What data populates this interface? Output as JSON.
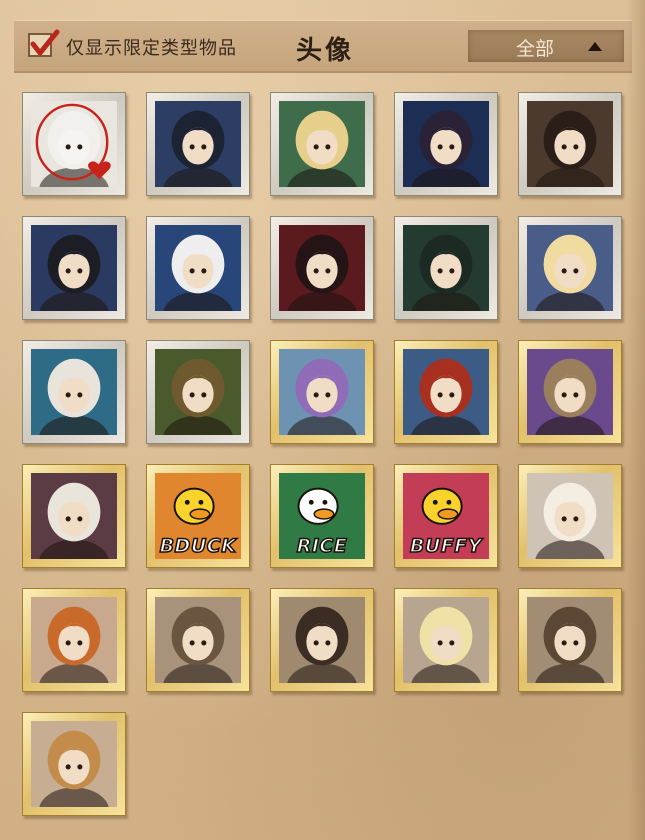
{
  "header": {
    "filter_label": "仅显示限定类型物品",
    "filter_checked": true,
    "title": "头像",
    "dropdown_value": "全部"
  },
  "colors": {
    "background": "#d5b58a",
    "frame_silver": "#e6e2da",
    "frame_gold": "#e8c874",
    "check_red": "#b8261c"
  },
  "avatars": [
    {
      "icon": "white-haired-doll-portrait",
      "frame": "silver",
      "bg": "#e9e6df",
      "selected": true
    },
    {
      "icon": "dark-armored-hunter-portrait",
      "frame": "silver",
      "bg": "#2c3e63"
    },
    {
      "icon": "blonde-green-goggles-portrait",
      "frame": "silver",
      "bg": "#3f6d4c"
    },
    {
      "icon": "dark-and-pale-pair-portrait",
      "frame": "silver",
      "bg": "#1d2e55"
    },
    {
      "icon": "dark-curly-hair-steampunk-portrait",
      "frame": "silver",
      "bg": "#4c3a2e"
    },
    {
      "icon": "dark-and-white-pair-portrait",
      "frame": "silver",
      "bg": "#2a3a60"
    },
    {
      "icon": "white-hair-top-hat-portrait",
      "frame": "silver",
      "bg": "#28467a"
    },
    {
      "icon": "red-flower-girl-portrait",
      "frame": "silver",
      "bg": "#5a1a1e"
    },
    {
      "icon": "dark-haired-ghost-portrait",
      "frame": "silver",
      "bg": "#243b32"
    },
    {
      "icon": "blonde-blindfold-portrait",
      "frame": "silver",
      "bg": "#4a5c88"
    },
    {
      "icon": "white-curls-masked-portrait",
      "frame": "silver",
      "bg": "#2d6b86"
    },
    {
      "icon": "mechanical-creature-portrait",
      "frame": "silver",
      "bg": "#4b5a2c"
    },
    {
      "icon": "purple-hooded-figure-portrait",
      "frame": "gold",
      "bg": "#6e93b2"
    },
    {
      "icon": "red-haired-masked-figure-portrait",
      "frame": "gold",
      "bg": "#3c5c86"
    },
    {
      "icon": "box-head-figure-portrait",
      "frame": "gold",
      "bg": "#6a4a8c"
    },
    {
      "icon": "white-haired-man-portrait",
      "frame": "gold",
      "bg": "#5b3b44"
    },
    {
      "icon": "duck-badge-bduck",
      "frame": "gold",
      "bg": "#e0862f",
      "text": "BDUCK"
    },
    {
      "icon": "duck-badge-rice",
      "frame": "gold",
      "bg": "#2f7a45",
      "text": "RICE"
    },
    {
      "icon": "duck-badge-buffy",
      "frame": "gold",
      "bg": "#c23d55",
      "text": "BUFFY"
    },
    {
      "icon": "pale-lady-red-eyes-portrait",
      "frame": "gold",
      "bg": "#cfc3b6"
    },
    {
      "icon": "orange-braids-girl-portrait",
      "frame": "gold",
      "bg": "#c8a98e"
    },
    {
      "icon": "mechanical-diver-portrait",
      "frame": "gold",
      "bg": "#a8927c"
    },
    {
      "icon": "hooded-button-eyes-portrait",
      "frame": "gold",
      "bg": "#9f8a70"
    },
    {
      "icon": "blonde-purple-face-portrait",
      "frame": "gold",
      "bg": "#b8a58f"
    },
    {
      "icon": "goggles-cat-ear-portrait",
      "frame": "gold",
      "bg": "#a38c74"
    },
    {
      "icon": "goggles-girl-portrait",
      "frame": "gold",
      "bg": "#c7ad92"
    }
  ]
}
